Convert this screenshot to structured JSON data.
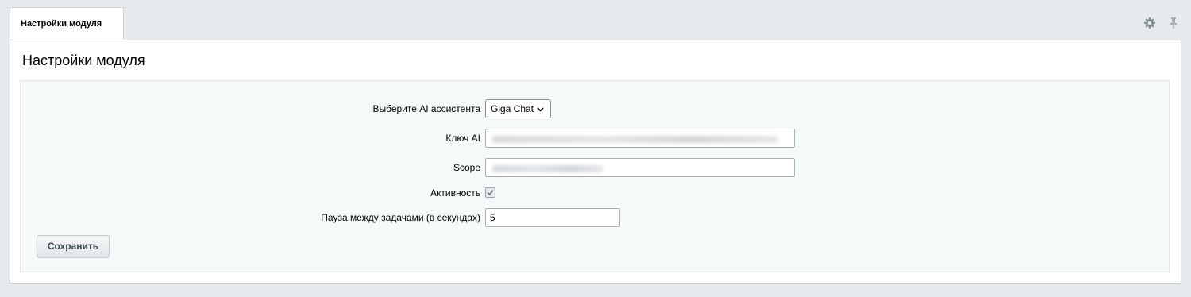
{
  "tab": {
    "label": "Настройки модуля"
  },
  "tab_icons": [
    "gear-icon",
    "pin-icon"
  ],
  "page": {
    "title": "Настройки модуля"
  },
  "form": {
    "assistant": {
      "label": "Выберите AI ассистента",
      "selected": "Giga Chat"
    },
    "api_key": {
      "label": "Ключ AI",
      "value_blurred": true
    },
    "scope": {
      "label": "Scope",
      "value_blurred": true
    },
    "active": {
      "label": "Активность",
      "checked": true
    },
    "pause": {
      "label": "Пауза между задачами (в секундах)",
      "value": "5"
    },
    "save_label": "Сохранить"
  }
}
